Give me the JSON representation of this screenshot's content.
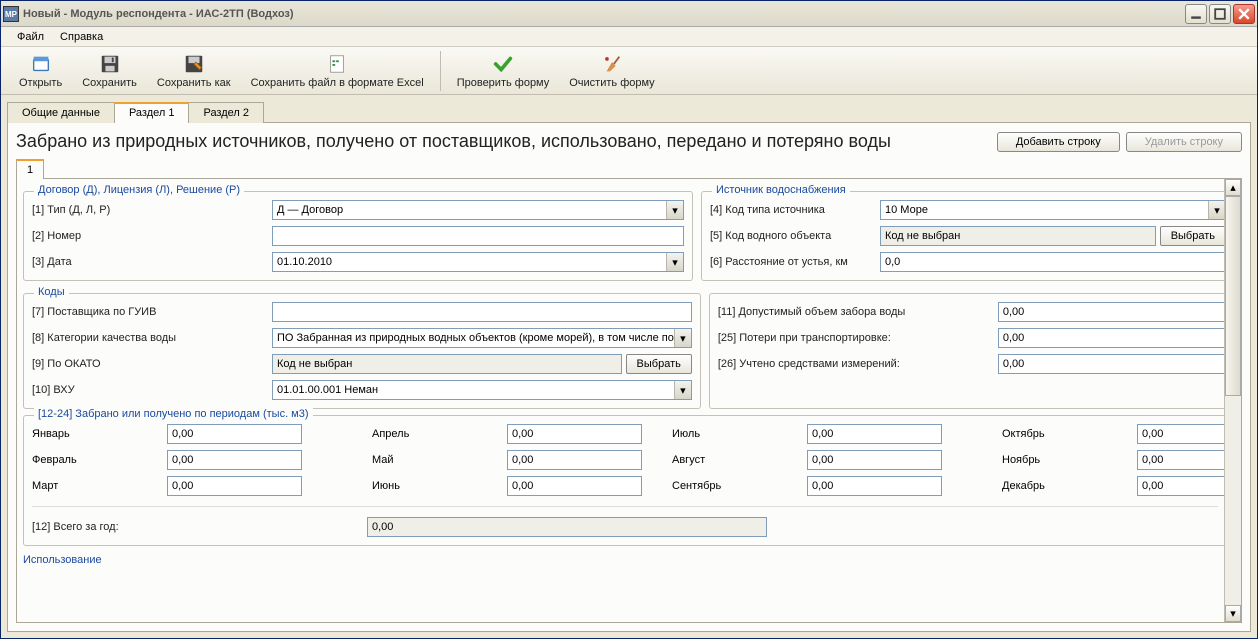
{
  "window": {
    "title": "Новый - Модуль респондента - ИАС-2ТП (Водхоз)"
  },
  "menu": {
    "file": "Файл",
    "help": "Справка"
  },
  "toolbar": {
    "open": "Открыть",
    "save": "Сохранить",
    "save_as": "Сохранить как",
    "save_excel": "Сохранить файл в формате Excel",
    "check": "Проверить форму",
    "clear": "Очистить форму"
  },
  "tabs": {
    "general": "Общие данные",
    "section1": "Раздел 1",
    "section2": "Раздел 2"
  },
  "section": {
    "title": "Забрано из природных источников, получено от поставщиков, использовано, передано и потеряно воды",
    "add_row": "Добавить строку",
    "del_row": "Удалить строку"
  },
  "inner_tab": "1",
  "group_contract": {
    "legend": "Договор (Д), Лицензия (Л), Решение (Р)",
    "type_label": "[1] Тип (Д, Л, Р)",
    "type_value": "Д — Договор",
    "number_label": "[2] Номер",
    "number_value": "",
    "date_label": "[3] Дата",
    "date_value": "01.10.2010"
  },
  "group_source": {
    "legend": "Источник водоснабжения",
    "src_type_label": "[4] Код типа источника",
    "src_type_value": "10 Море",
    "obj_code_label": "[5] Код водного объекта",
    "obj_code_value": "Код не выбран",
    "select_btn": "Выбрать",
    "dist_label": "[6] Расстояние от устья, км",
    "dist_value": "0,0"
  },
  "group_codes": {
    "legend": "Коды",
    "supplier_label": "[7] Поставщика по ГУИВ",
    "supplier_value": "",
    "quality_label": "[8] Категории качества воды",
    "quality_value": "ПО Забранная из природных водных объектов (кроме морей), в том числе по",
    "okato_label": "[9] По ОКАТО",
    "okato_value": "Код не выбран",
    "select_btn": "Выбрать",
    "vhu_label": "[10] ВХУ",
    "vhu_value": "01.01.00.001 Неман"
  },
  "group_limits": {
    "vol_label": "[11] Допустимый объем забора воды",
    "vol_value": "0,00",
    "loss_label": "[25] Потери при транспортировке:",
    "loss_value": "0,00",
    "meas_label": "[26] Учтено средствами измерений:",
    "meas_value": "0,00"
  },
  "group_periods": {
    "legend": "[12-24] Забрано или получено по периодам (тыс. м3)",
    "months": {
      "jan": "Январь",
      "feb": "Февраль",
      "mar": "Март",
      "apr": "Апрель",
      "may": "Май",
      "jun": "Июнь",
      "jul": "Июль",
      "aug": "Август",
      "sep": "Сентябрь",
      "oct": "Октябрь",
      "nov": "Ноябрь",
      "dec": "Декабрь"
    },
    "values": {
      "jan": "0,00",
      "feb": "0,00",
      "mar": "0,00",
      "apr": "0,00",
      "may": "0,00",
      "jun": "0,00",
      "jul": "0,00",
      "aug": "0,00",
      "sep": "0,00",
      "oct": "0,00",
      "nov": "0,00",
      "dec": "0,00"
    },
    "total_label": "[12] Всего за год:",
    "total_value": "0,00"
  },
  "usage_legend": "Использование"
}
